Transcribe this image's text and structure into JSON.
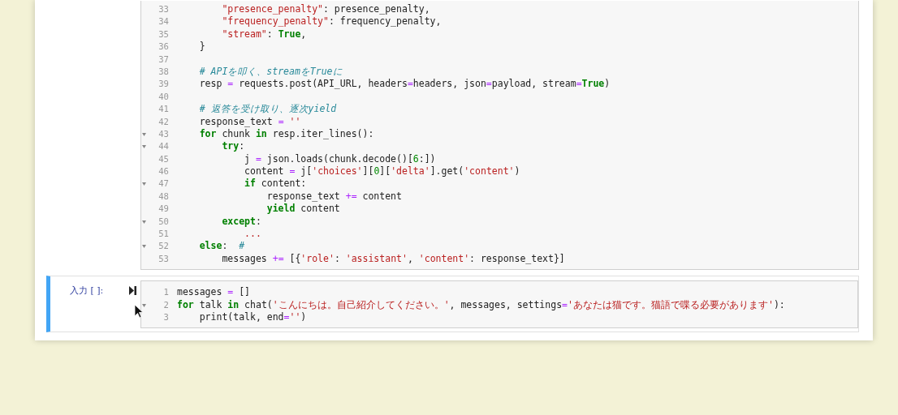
{
  "cells": [
    {
      "run_button": false,
      "selected": false,
      "lines": [
        {
          "number": "33",
          "fold": false,
          "tokens": [
            {
              "kind": "s",
              "text": "        \"presence_penalty\""
            },
            {
              "kind": "p",
              "text": ": presence_penalty,"
            }
          ]
        },
        {
          "number": "34",
          "fold": false,
          "tokens": [
            {
              "kind": "s",
              "text": "        \"frequency_penalty\""
            },
            {
              "kind": "p",
              "text": ": frequency_penalty,"
            }
          ]
        },
        {
          "number": "35",
          "fold": false,
          "tokens": [
            {
              "kind": "s",
              "text": "        \"stream\""
            },
            {
              "kind": "p",
              "text": ": "
            },
            {
              "kind": "k",
              "text": "True"
            },
            {
              "kind": "p",
              "text": ","
            }
          ]
        },
        {
          "number": "36",
          "fold": false,
          "tokens": [
            {
              "kind": "p",
              "text": "    }"
            }
          ]
        },
        {
          "number": "37",
          "fold": false
        },
        {
          "number": "38",
          "fold": false,
          "tokens": [
            {
              "kind": "c",
              "text": "    # APIを叩く、streamをTrueに"
            }
          ]
        },
        {
          "number": "39",
          "fold": false,
          "tokens": [
            {
              "kind": "p",
              "text": "    resp "
            },
            {
              "kind": "o",
              "text": "="
            },
            {
              "kind": "p",
              "text": " requests.post(API_URL, headers"
            },
            {
              "kind": "o",
              "text": "="
            },
            {
              "kind": "p",
              "text": "headers, json"
            },
            {
              "kind": "o",
              "text": "="
            },
            {
              "kind": "p",
              "text": "payload, stream"
            },
            {
              "kind": "o",
              "text": "="
            },
            {
              "kind": "k",
              "text": "True"
            },
            {
              "kind": "p",
              "text": ")"
            }
          ]
        },
        {
          "number": "40",
          "fold": false
        },
        {
          "number": "41",
          "fold": false,
          "tokens": [
            {
              "kind": "c",
              "text": "    # 返答を受け取り、逐次yield"
            }
          ]
        },
        {
          "number": "42",
          "fold": false,
          "tokens": [
            {
              "kind": "p",
              "text": "    response_text "
            },
            {
              "kind": "o",
              "text": "="
            },
            {
              "kind": "s",
              "text": " ''"
            }
          ]
        },
        {
          "number": "43",
          "fold": true,
          "tokens": [
            {
              "kind": "k",
              "text": "    for"
            },
            {
              "kind": "p",
              "text": " chunk "
            },
            {
              "kind": "k",
              "text": "in"
            },
            {
              "kind": "p",
              "text": " resp.iter_lines():"
            }
          ]
        },
        {
          "number": "44",
          "fold": true,
          "tokens": [
            {
              "kind": "k",
              "text": "        try"
            },
            {
              "kind": "p",
              "text": ":"
            }
          ]
        },
        {
          "number": "45",
          "fold": false,
          "tokens": [
            {
              "kind": "p",
              "text": "            j "
            },
            {
              "kind": "o",
              "text": "="
            },
            {
              "kind": "p",
              "text": " json.loads(chunk.decode()["
            },
            {
              "kind": "n",
              "text": "6"
            },
            {
              "kind": "p",
              "text": ":])"
            }
          ]
        },
        {
          "number": "46",
          "fold": false,
          "tokens": [
            {
              "kind": "p",
              "text": "            content "
            },
            {
              "kind": "o",
              "text": "="
            },
            {
              "kind": "p",
              "text": " j["
            },
            {
              "kind": "s",
              "text": "'choices'"
            },
            {
              "kind": "p",
              "text": "]["
            },
            {
              "kind": "n",
              "text": "0"
            },
            {
              "kind": "p",
              "text": "]["
            },
            {
              "kind": "s",
              "text": "'delta'"
            },
            {
              "kind": "p",
              "text": "].get("
            },
            {
              "kind": "s",
              "text": "'content'"
            },
            {
              "kind": "p",
              "text": ")"
            }
          ]
        },
        {
          "number": "47",
          "fold": true,
          "tokens": [
            {
              "kind": "k",
              "text": "            if"
            },
            {
              "kind": "p",
              "text": " content:"
            }
          ]
        },
        {
          "number": "48",
          "fold": false,
          "tokens": [
            {
              "kind": "p",
              "text": "                response_text "
            },
            {
              "kind": "o",
              "text": "+="
            },
            {
              "kind": "p",
              "text": " content"
            }
          ]
        },
        {
          "number": "49",
          "fold": false,
          "tokens": [
            {
              "kind": "k",
              "text": "                yield"
            },
            {
              "kind": "p",
              "text": " content"
            }
          ]
        },
        {
          "number": "50",
          "fold": true,
          "tokens": [
            {
              "kind": "k",
              "text": "        except"
            },
            {
              "kind": "p",
              "text": ":"
            }
          ]
        },
        {
          "number": "51",
          "fold": false,
          "tokens": [
            {
              "kind": "s",
              "text": "            ..."
            }
          ]
        },
        {
          "number": "52",
          "fold": true,
          "tokens": [
            {
              "kind": "k",
              "text": "    else"
            },
            {
              "kind": "p",
              "text": ":"
            },
            {
              "kind": "c",
              "text": "  #"
            }
          ]
        },
        {
          "number": "53",
          "fold": false,
          "tokens": [
            {
              "kind": "p",
              "text": "        messages "
            },
            {
              "kind": "o",
              "text": "+="
            },
            {
              "kind": "p",
              "text": " [{"
            },
            {
              "kind": "s",
              "text": "'role'"
            },
            {
              "kind": "p",
              "text": ": "
            },
            {
              "kind": "s",
              "text": "'assistant'"
            },
            {
              "kind": "p",
              "text": ", "
            },
            {
              "kind": "s",
              "text": "'content'"
            },
            {
              "kind": "p",
              "text": ": response_text}]"
            }
          ]
        }
      ]
    },
    {
      "prompt": "入力 [ ]:",
      "run_button": true,
      "selected": true,
      "lines": [
        {
          "number": "1",
          "fold": false,
          "tokens": [
            {
              "kind": "p",
              "text": "messages "
            },
            {
              "kind": "o",
              "text": "="
            },
            {
              "kind": "p",
              "text": " []"
            }
          ]
        },
        {
          "number": "2",
          "fold": true,
          "tokens": [
            {
              "kind": "k",
              "text": "for"
            },
            {
              "kind": "p",
              "text": " talk "
            },
            {
              "kind": "k",
              "text": "in"
            },
            {
              "kind": "p",
              "text": " chat("
            },
            {
              "kind": "s",
              "text": "'こんにちは。自己紹介してください。'"
            },
            {
              "kind": "p",
              "text": ", messages, settings"
            },
            {
              "kind": "o",
              "text": "="
            },
            {
              "kind": "s",
              "text": "'あなたは猫です。猫語で喋る必要があります'"
            },
            {
              "kind": "p",
              "text": "):"
            }
          ]
        },
        {
          "number": "3",
          "fold": false,
          "tokens": [
            {
              "kind": "p",
              "text": "    print(talk, end"
            },
            {
              "kind": "o",
              "text": "="
            },
            {
              "kind": "s",
              "text": "''"
            },
            {
              "kind": "p",
              "text": ")"
            }
          ]
        }
      ]
    }
  ]
}
